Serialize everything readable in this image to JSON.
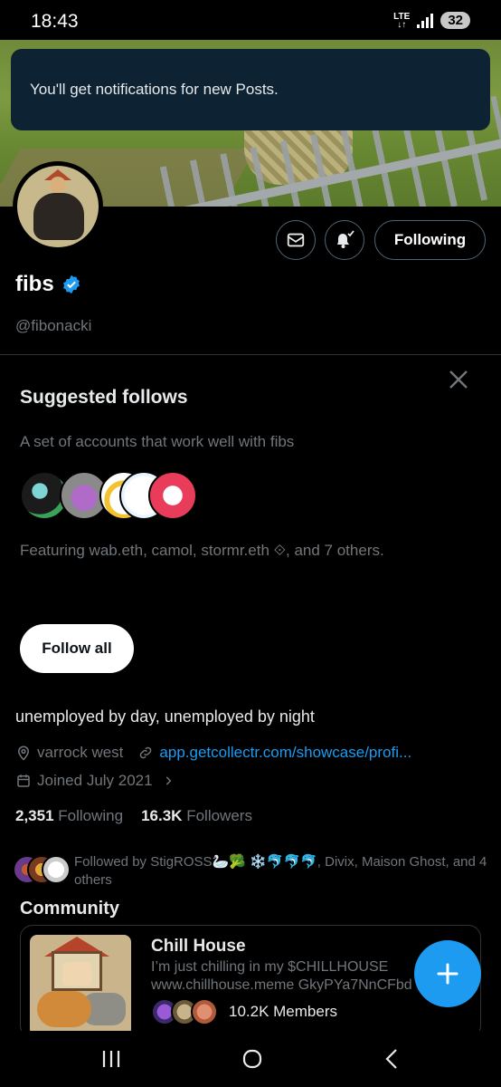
{
  "status_bar": {
    "time": "18:43",
    "network": "LTE",
    "battery": "32"
  },
  "toast": {
    "message": "You'll get notifications for new Posts."
  },
  "profile": {
    "actions": {
      "message_icon": "envelope-icon",
      "notify_icon": "bell-check-icon",
      "following_label": "Following"
    },
    "name": "fibs",
    "verified": true,
    "handle": "@fibonacki",
    "bio": "unemployed by day, unemployed by night",
    "location": "varrock west",
    "link": "app.getcollectr.com/showcase/profi...",
    "joined": "Joined July 2021",
    "following_count": "2,351",
    "following_label": "Following",
    "followers_count": "16.3K",
    "followers_label": "Followers"
  },
  "suggested": {
    "title": "Suggested follows",
    "subtitle": "A set of accounts that work well with fibs",
    "featuring": "Featuring wab.eth, camol, stormr.eth ⟐, and 7 others.",
    "follow_all_label": "Follow all"
  },
  "followed_by": {
    "text": "Followed by StigROSS🦢🥦 ❄️🐬🐬🐬, Divix, Maison Ghost, and 4 others"
  },
  "community": {
    "section_title": "Community",
    "name": "Chill House",
    "description_line1": "I’m just chilling in my $CHILLHOUSE",
    "description_line2": "www.chillhouse.meme GkyPYa7NnCFbd",
    "members": "10.2K Members"
  },
  "colors": {
    "accent": "#1d9bf0",
    "background": "#000000",
    "secondary_text": "#71767b",
    "border": "#2f3336",
    "toast_bg": "#0d2233"
  }
}
